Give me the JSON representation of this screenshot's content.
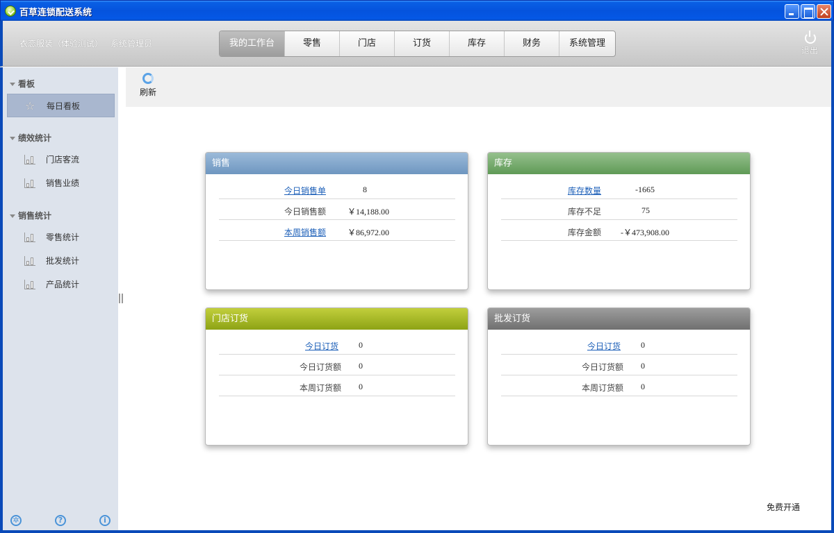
{
  "window": {
    "title": "百草连锁配送系统"
  },
  "header": {
    "company": "衣恋服装（体验测试）",
    "user_role": "系统管理员",
    "logout_label": "退出",
    "tabs": [
      {
        "label": "我的工作台",
        "active": true
      },
      {
        "label": "零售"
      },
      {
        "label": "门店"
      },
      {
        "label": "订货"
      },
      {
        "label": "库存"
      },
      {
        "label": "财务"
      },
      {
        "label": "系统管理"
      }
    ]
  },
  "sidebar": {
    "groups": [
      {
        "label": "看板",
        "items": [
          {
            "label": "每日看板",
            "icon": "star-icon",
            "active": true
          }
        ]
      },
      {
        "label": "绩效统计",
        "items": [
          {
            "label": "门店客流",
            "icon": "bar-chart-icon"
          },
          {
            "label": "销售业绩",
            "icon": "bar-chart-icon"
          }
        ]
      },
      {
        "label": "销售统计",
        "items": [
          {
            "label": "零售统计",
            "icon": "bar-chart-icon"
          },
          {
            "label": "批发统计",
            "icon": "bar-chart-icon"
          },
          {
            "label": "产品统计",
            "icon": "bar-chart-icon"
          }
        ]
      }
    ],
    "footer_icons": [
      "gear-icon",
      "help-icon",
      "info-icon"
    ]
  },
  "toolbar": {
    "refresh_label": "刷新"
  },
  "cards": {
    "sales": {
      "title": "销售",
      "rows": [
        {
          "label": "今日销售单",
          "value": "8",
          "link": true
        },
        {
          "label": "今日销售额",
          "value": "￥14,188.00",
          "link": false
        },
        {
          "label": "本周销售额",
          "value": "￥86,972.00",
          "link": true
        }
      ]
    },
    "stock": {
      "title": "库存",
      "rows": [
        {
          "label": "库存数量",
          "value": "-1665",
          "link": true
        },
        {
          "label": "库存不足",
          "value": "75",
          "link": false
        },
        {
          "label": "库存金额",
          "value": "-￥473,908.00",
          "link": false
        }
      ]
    },
    "store_order": {
      "title": "门店订货",
      "rows": [
        {
          "label": "今日订货",
          "value": "0",
          "link": true
        },
        {
          "label": "今日订货额",
          "value": "0",
          "link": false
        },
        {
          "label": "本周订货额",
          "value": "0",
          "link": false
        }
      ]
    },
    "wholesale_order": {
      "title": "批发订货",
      "rows": [
        {
          "label": "今日订货",
          "value": "0",
          "link": true
        },
        {
          "label": "今日订货额",
          "value": "0",
          "link": false
        },
        {
          "label": "本周订货额",
          "value": "0",
          "link": false
        }
      ]
    }
  },
  "footer": {
    "free_open_label": "免费开通"
  },
  "colors": {
    "title_bar": "#0553dd",
    "link": "#1c5fb8",
    "sidebar_bg": "#dde3ec",
    "active_item": "#a9b7cf"
  }
}
